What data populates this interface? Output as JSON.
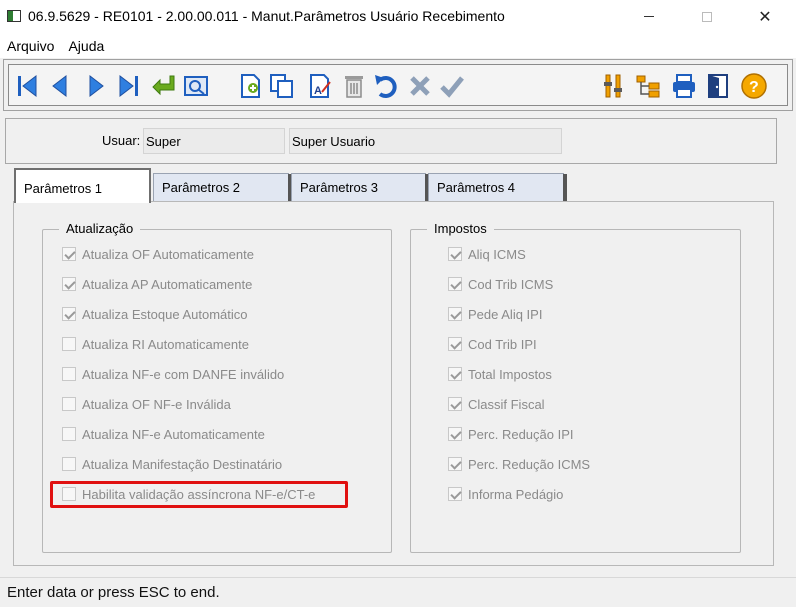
{
  "window": {
    "title": "06.9.5629 - RE0101 - 2.00.00.011 - Manut.Parâmetros Usuário Recebimento",
    "minimize": "—",
    "maximize": "☐",
    "close": "✕"
  },
  "menu": {
    "items": [
      "Arquivo",
      "Ajuda"
    ]
  },
  "toolbar": {
    "buttons": [
      {
        "name": "first-record-icon"
      },
      {
        "name": "previous-record-icon"
      },
      {
        "name": "next-record-icon"
      },
      {
        "name": "last-record-icon"
      },
      {
        "name": "goto-icon"
      },
      {
        "name": "search-icon"
      },
      {
        "name": "add-icon"
      },
      {
        "name": "copy-icon"
      },
      {
        "name": "edit-icon"
      },
      {
        "name": "delete-icon"
      },
      {
        "name": "undo-icon"
      },
      {
        "name": "cancel-icon"
      },
      {
        "name": "confirm-icon"
      },
      {
        "name": "tools-icon"
      },
      {
        "name": "tree-icon"
      },
      {
        "name": "print-icon"
      },
      {
        "name": "exit-icon"
      },
      {
        "name": "help-icon"
      }
    ],
    "colors": {
      "blue": "#1f5fbf",
      "green": "#5a9a1a",
      "gray": "#8c8c8c",
      "orange": "#f0a000"
    }
  },
  "header": {
    "user_label": "Usuar:",
    "user_code": "Super",
    "user_name": "Super Usuario"
  },
  "tabs": [
    {
      "label": "Parâmetros 1",
      "active": true
    },
    {
      "label": "Parâmetros 2",
      "active": false
    },
    {
      "label": "Parâmetros 3",
      "active": false
    },
    {
      "label": "Parâmetros 4",
      "active": false
    }
  ],
  "atualizacao": {
    "legend": "Atualização",
    "items": [
      {
        "label": "Atualiza OF Automaticamente",
        "checked": true
      },
      {
        "label": "Atualiza AP Automaticamente",
        "checked": true
      },
      {
        "label": "Atualiza Estoque Automático",
        "checked": true
      },
      {
        "label": "Atualiza RI Automaticamente",
        "checked": false
      },
      {
        "label": "Atualiza NF-e com DANFE inválido",
        "checked": false
      },
      {
        "label": "Atualiza OF NF-e Inválida",
        "checked": false
      },
      {
        "label": "Atualiza NF-e Automaticamente",
        "checked": false
      },
      {
        "label": "Atualiza Manifestação Destinatário",
        "checked": false
      },
      {
        "label": "Habilita validação assíncrona NF-e/CT-e",
        "checked": false
      }
    ]
  },
  "impostos": {
    "legend": "Impostos",
    "items": [
      {
        "label": "Aliq ICMS",
        "checked": true
      },
      {
        "label": "Cod Trib ICMS",
        "checked": true
      },
      {
        "label": "Pede Aliq IPI",
        "checked": true
      },
      {
        "label": "Cod Trib IPI",
        "checked": true
      },
      {
        "label": "Total Impostos",
        "checked": true
      },
      {
        "label": "Classif Fiscal",
        "checked": true
      },
      {
        "label": "Perc. Redução IPI",
        "checked": true
      },
      {
        "label": "Perc. Redução ICMS",
        "checked": true
      },
      {
        "label": "Informa Pedágio",
        "checked": true
      }
    ]
  },
  "highlight_color": "#e01010",
  "status": {
    "text": "Enter data or press ESC to end."
  }
}
